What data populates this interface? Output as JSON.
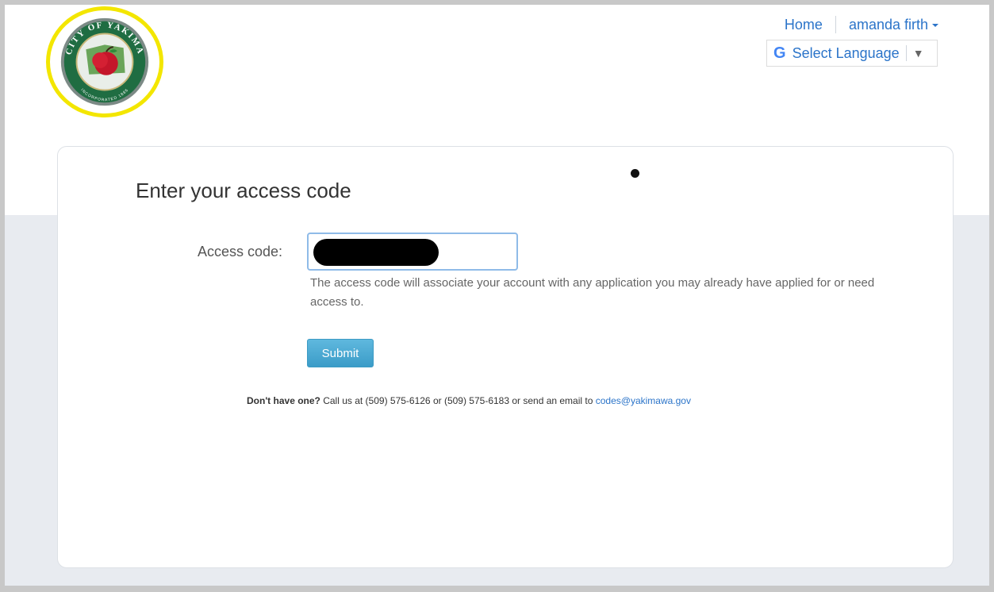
{
  "header": {
    "logo_alt": "City of Yakima seal",
    "logo_text_top": "CITY OF YAKIMA",
    "logo_text_bottom": "INCORPORATED 1886",
    "nav_home": "Home",
    "nav_user": "amanda firth",
    "language_label": "Select Language",
    "language_arrow": "▼",
    "google_icon": "G"
  },
  "card": {
    "title": "Enter your access code",
    "field_label": "Access code:",
    "field_value": "",
    "help_text": "The access code will associate your account with any application you may already have applied for or need access to.",
    "submit_label": "Submit",
    "footer_prefix_bold": "Don't have one?",
    "footer_text": " Call us at (509) 575-6126 or (509) 575-6183 or send an email to ",
    "footer_email": "codes@yakimawa.gov"
  },
  "colors": {
    "accent_link": "#2b74c9",
    "button": "#3b9cc8",
    "logo_ring": "#f3e600",
    "band": "#e8ebf0"
  },
  "icons": {
    "google": "google-g-icon",
    "dropdown": "chevron-down-icon",
    "caret": "caret-down-icon"
  }
}
